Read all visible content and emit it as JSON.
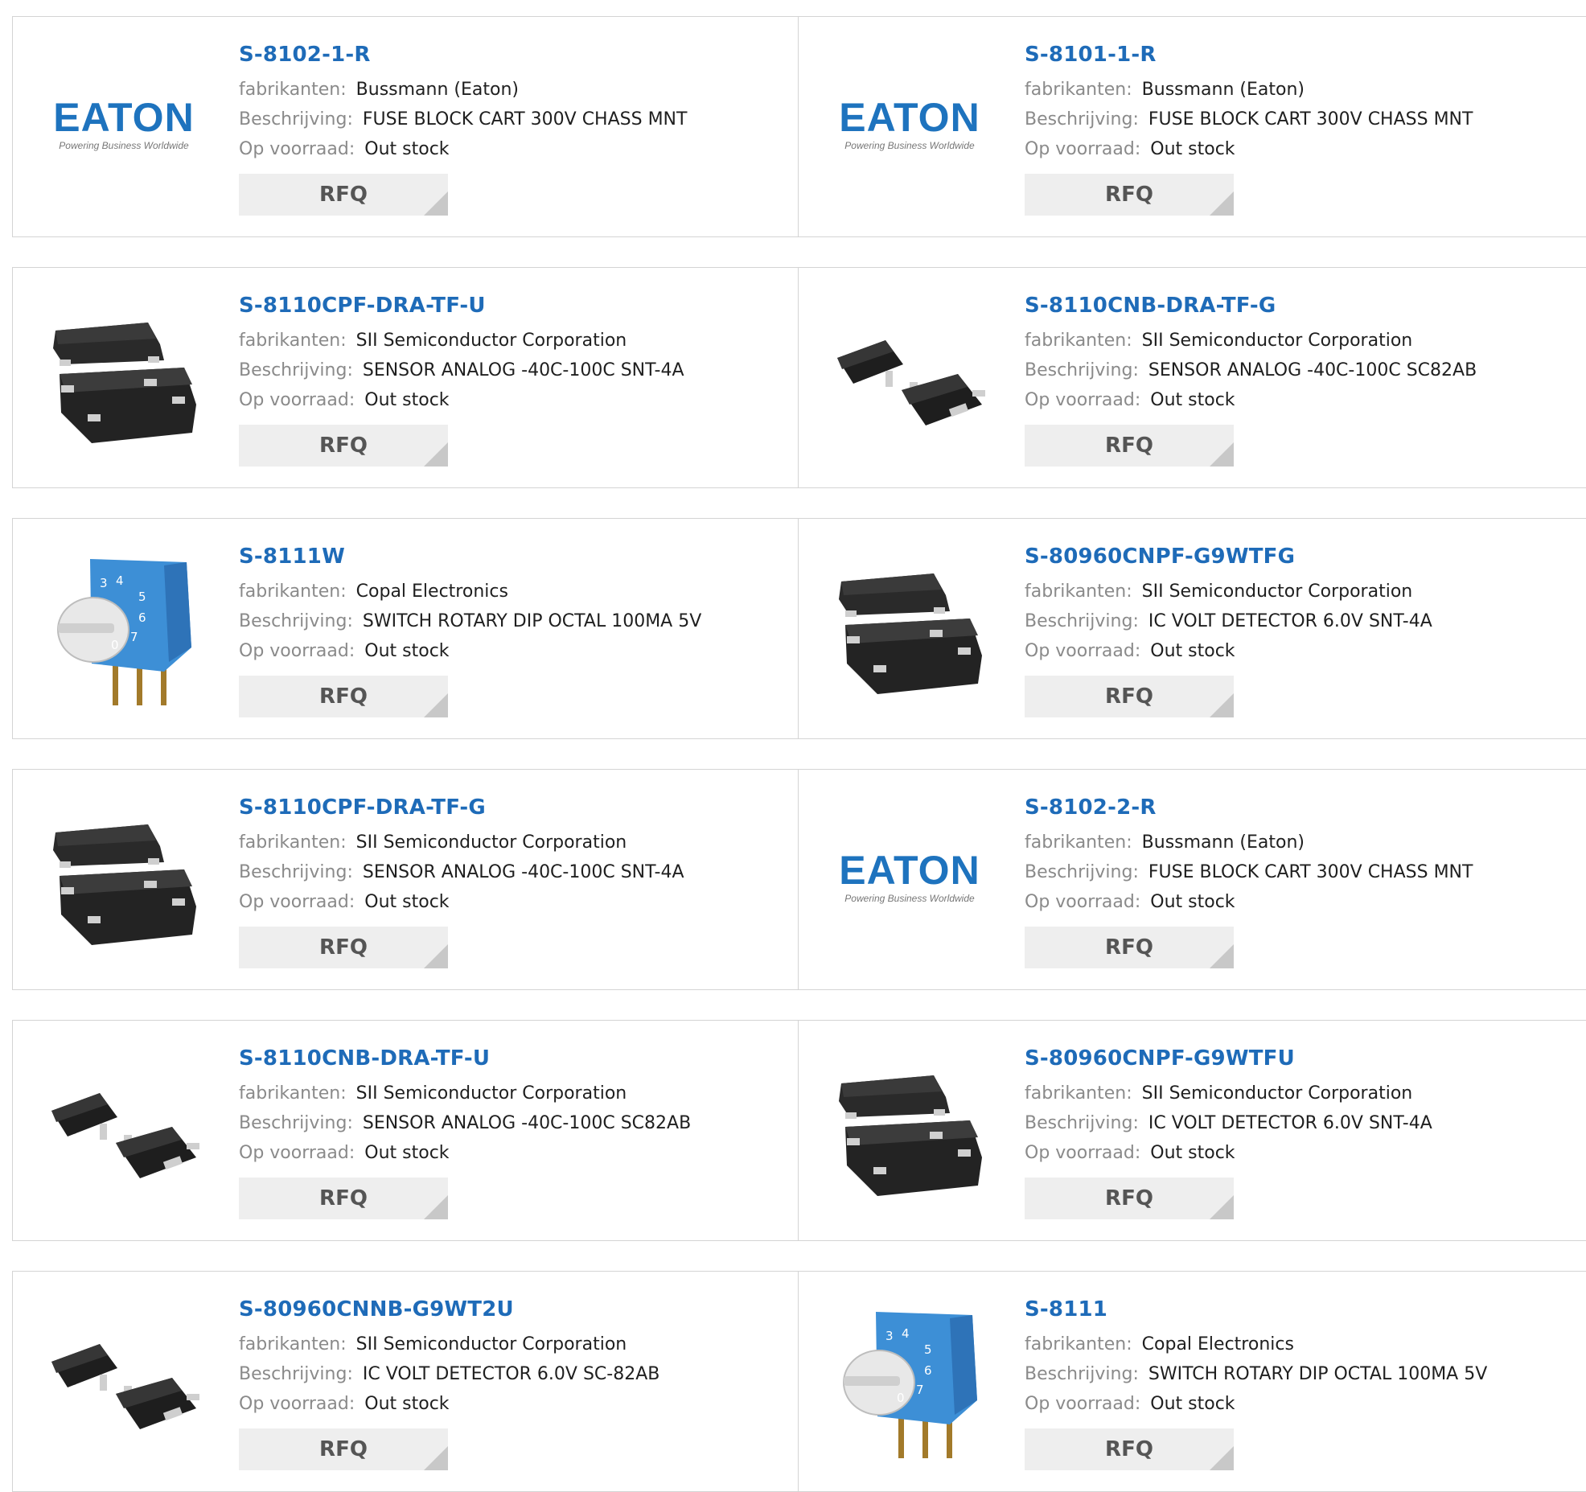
{
  "labels": {
    "manufacturer": "fabrikanten:",
    "description": "Beschrijving:",
    "stock": "Op voorraad:",
    "rfq": "RFQ"
  },
  "brand": {
    "eaton_logo_text": "EATON",
    "eaton_tagline": "Powering Business Worldwide",
    "dial_digits": [
      "3",
      "4",
      "5",
      "6",
      "7",
      "0"
    ]
  },
  "colors": {
    "link": "#1e6bb8",
    "eaton_blue": "#1e73be",
    "dial_blue": "#3d8fd6"
  },
  "products": [
    {
      "part": "S-8102-1-R",
      "manufacturer": "Bussmann (Eaton)",
      "description": "FUSE BLOCK CART 300V CHASS MNT",
      "stock": "Out stock",
      "image": "eaton-logo"
    },
    {
      "part": "S-8101-1-R",
      "manufacturer": "Bussmann (Eaton)",
      "description": "FUSE BLOCK CART 300V CHASS MNT",
      "stock": "Out stock",
      "image": "eaton-logo"
    },
    {
      "part": "S-8110CPF-DRA-TF-U",
      "manufacturer": "SII Semiconductor Corporation",
      "description": "SENSOR ANALOG -40C-100C SNT-4A",
      "stock": "Out stock",
      "image": "snt4a-chip"
    },
    {
      "part": "S-8110CNB-DRA-TF-G",
      "manufacturer": "SII Semiconductor Corporation",
      "description": "SENSOR ANALOG -40C-100C SC82AB",
      "stock": "Out stock",
      "image": "sc82ab-chip"
    },
    {
      "part": "S-8111W",
      "manufacturer": "Copal Electronics",
      "description": "SWITCH ROTARY DIP OCTAL 100MA 5V",
      "stock": "Out stock",
      "image": "rotary-switch"
    },
    {
      "part": "S-80960CNPF-G9WTFG",
      "manufacturer": "SII Semiconductor Corporation",
      "description": "IC VOLT DETECTOR 6.0V SNT-4A",
      "stock": "Out stock",
      "image": "snt4a-chip"
    },
    {
      "part": "S-8110CPF-DRA-TF-G",
      "manufacturer": "SII Semiconductor Corporation",
      "description": "SENSOR ANALOG -40C-100C SNT-4A",
      "stock": "Out stock",
      "image": "snt4a-chip"
    },
    {
      "part": "S-8102-2-R",
      "manufacturer": "Bussmann (Eaton)",
      "description": "FUSE BLOCK CART 300V CHASS MNT",
      "stock": "Out stock",
      "image": "eaton-logo"
    },
    {
      "part": "S-8110CNB-DRA-TF-U",
      "manufacturer": "SII Semiconductor Corporation",
      "description": "SENSOR ANALOG -40C-100C SC82AB",
      "stock": "Out stock",
      "image": "sc82ab-chip"
    },
    {
      "part": "S-80960CNPF-G9WTFU",
      "manufacturer": "SII Semiconductor Corporation",
      "description": "IC VOLT DETECTOR 6.0V SNT-4A",
      "stock": "Out stock",
      "image": "snt4a-chip"
    },
    {
      "part": "S-80960CNNB-G9WT2U",
      "manufacturer": "SII Semiconductor Corporation",
      "description": "IC VOLT DETECTOR 6.0V SC-82AB",
      "stock": "Out stock",
      "image": "sc82ab-chip"
    },
    {
      "part": "S-8111",
      "manufacturer": "Copal Electronics",
      "description": "SWITCH ROTARY DIP OCTAL 100MA 5V",
      "stock": "Out stock",
      "image": "rotary-switch"
    }
  ]
}
